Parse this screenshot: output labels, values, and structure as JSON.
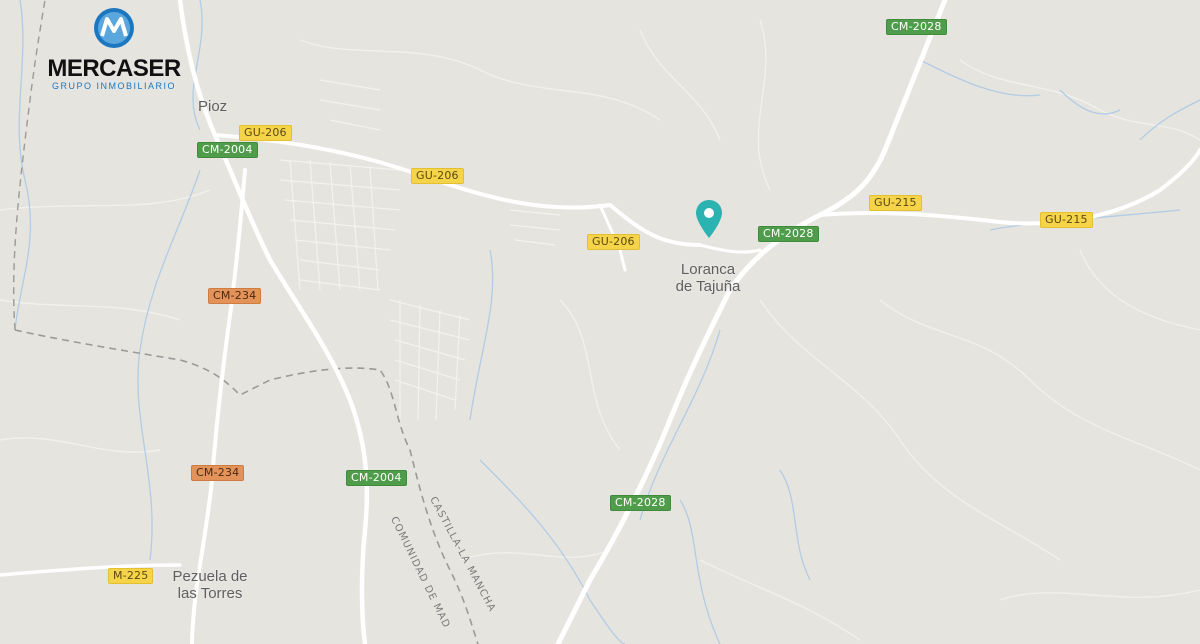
{
  "logo": {
    "brand": "MERCASER",
    "tagline": "GRUPO INMOBILIARIO",
    "colors": {
      "primary": "#1b78c0",
      "text": "#111111"
    }
  },
  "map": {
    "background_color": "#e6e4df",
    "road_color": "#ffffff",
    "water_color": "#a8c8e6",
    "pin_color": "#2bb3b1",
    "pin_icon": "location-pin-icon"
  },
  "places": {
    "pioz": "Pioz",
    "loranca_line1": "Loranca",
    "loranca_line2": "de Tajuña",
    "pezuela_line1": "Pezuela de",
    "pezuela_line2": "las Torres"
  },
  "road_labels": {
    "cm2028_top": "CM-2028",
    "gu206_a": "GU-206",
    "cm2004_a": "CM-2004",
    "gu206_b": "GU-206",
    "gu206_c": "GU-206",
    "cm2028_mid": "CM-2028",
    "gu215_a": "GU-215",
    "gu215_b": "GU-215",
    "cm234_a": "CM-234",
    "cm234_b": "CM-234",
    "cm2004_b": "CM-2004",
    "cm2028_bottom": "CM-2028",
    "m225": "M-225"
  },
  "borders": {
    "castilla": "CASTILLA-LA MANCHA",
    "comunidad": "COMUNIDAD DE MAD"
  }
}
